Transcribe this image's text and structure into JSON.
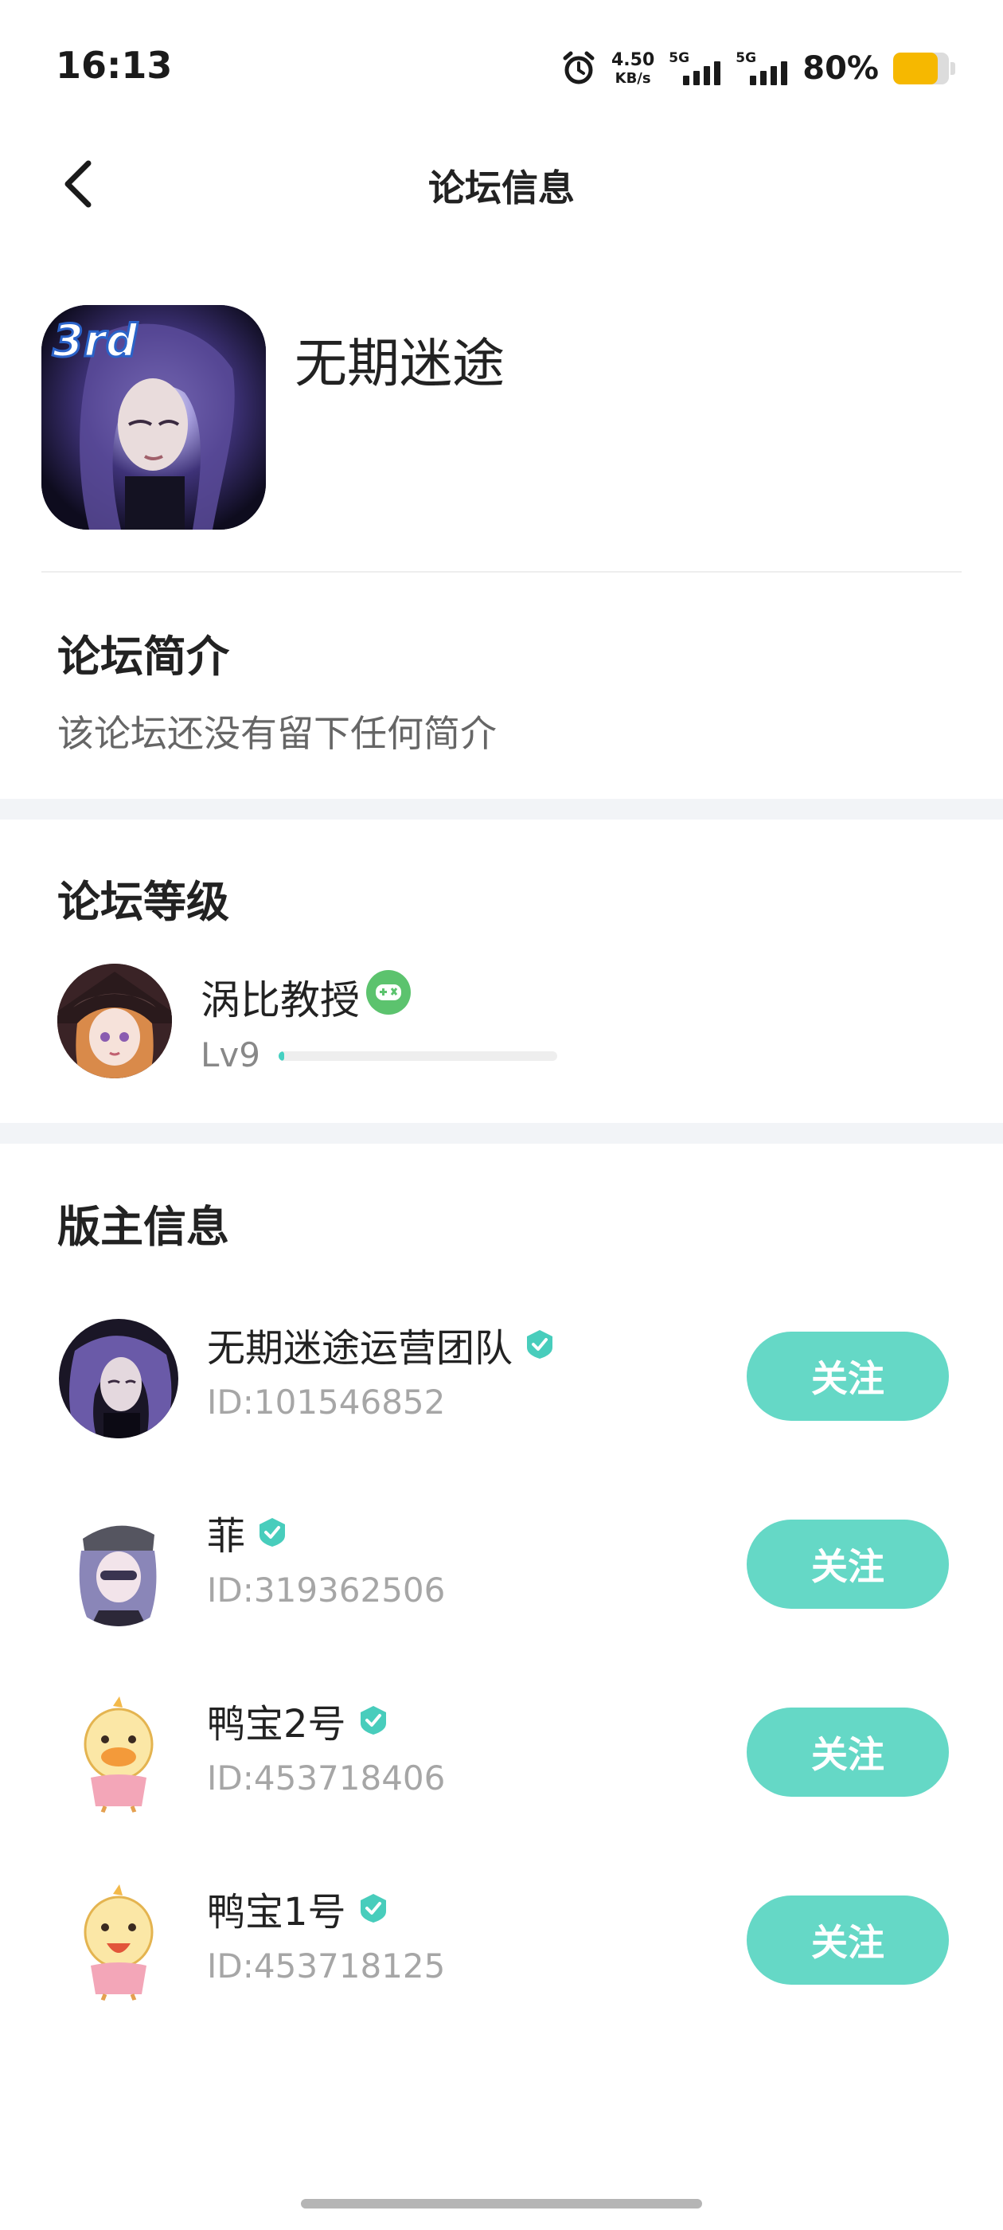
{
  "status_bar": {
    "time": "16:13",
    "net_speed_value": "4.50",
    "net_speed_unit": "KB/s",
    "signal_1_label": "5G",
    "signal_2_label": "5G",
    "battery_percent_text": "80%",
    "battery_level": 0.8,
    "battery_color": "#f6b800"
  },
  "nav": {
    "back_icon": "chevron-left-icon",
    "title": "论坛信息"
  },
  "forum": {
    "name": "无期迷途",
    "logo_badge": "3rd"
  },
  "intro": {
    "title": "论坛简介",
    "text": "该论坛还没有留下任何简介"
  },
  "level": {
    "title": "论坛等级",
    "user_name": "涡比教授",
    "badge_icon": "gamepad-icon",
    "level_text": "Lv9",
    "progress": 0.02,
    "progress_color": "#45d0c1"
  },
  "moderators": {
    "title": "版主信息",
    "follow_color": "#65d8c6",
    "items": [
      {
        "name": "无期迷途运营团队",
        "id": "ID:101546852",
        "follow_label": "关注",
        "verified": true
      },
      {
        "name": "菲",
        "id": "ID:319362506",
        "follow_label": "关注",
        "verified": true
      },
      {
        "name": "鸭宝2号",
        "id": "ID:453718406",
        "follow_label": "关注",
        "verified": true
      },
      {
        "name": "鸭宝1号",
        "id": "ID:453718125",
        "follow_label": "关注",
        "verified": true
      }
    ]
  }
}
